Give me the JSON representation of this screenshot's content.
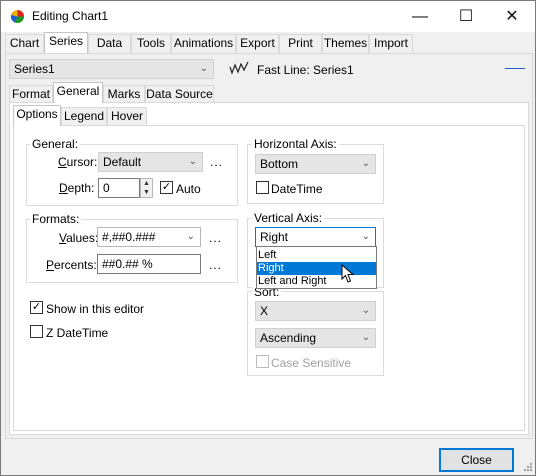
{
  "window": {
    "title": "Editing Chart1",
    "minimize_glyph": "—",
    "maximize_glyph": "☐",
    "close_glyph": "✕"
  },
  "main_tabs": [
    "Chart",
    "Series",
    "Data",
    "Tools",
    "Animations",
    "Export",
    "Print",
    "Themes",
    "Import"
  ],
  "series_selector": {
    "value": "Series1",
    "series_type_label": "Fast Line: Series1"
  },
  "series_tabs": [
    "Format",
    "General",
    "Marks",
    "Data Source"
  ],
  "general_tabs": [
    "Options",
    "Legend",
    "Hover"
  ],
  "general_group": {
    "title": "General:",
    "cursor_label": "Cursor:",
    "cursor_value": "Default",
    "depth_label": "Depth:",
    "depth_value": "0",
    "auto_label": "Auto",
    "auto_checked": true,
    "ellipsis": "..."
  },
  "formats_group": {
    "title": "Formats:",
    "values_label": "Values:",
    "values_value": "#,##0.###",
    "percents_label": "Percents:",
    "percents_value": "##0.## %",
    "ellipsis": "..."
  },
  "show_in_editor": {
    "label": "Show in this editor",
    "checked": true
  },
  "z_datetime": {
    "label": "Z DateTime",
    "checked": false
  },
  "horizontal_axis": {
    "title": "Horizontal Axis:",
    "value": "Bottom",
    "datetime_label": "DateTime"
  },
  "vertical_axis": {
    "title": "Vertical Axis:",
    "value": "Right",
    "options": [
      "Left",
      "Right",
      "Left and Right"
    ],
    "highlighted": "Right"
  },
  "sort": {
    "title": "Sort:",
    "field_value": "X",
    "order_value": "Ascending",
    "case_sensitive_label": "Case Sensitive"
  },
  "footer": {
    "close_label": "Close"
  },
  "colors": {
    "accent": "#0078d7",
    "selection": "#0078d7"
  }
}
